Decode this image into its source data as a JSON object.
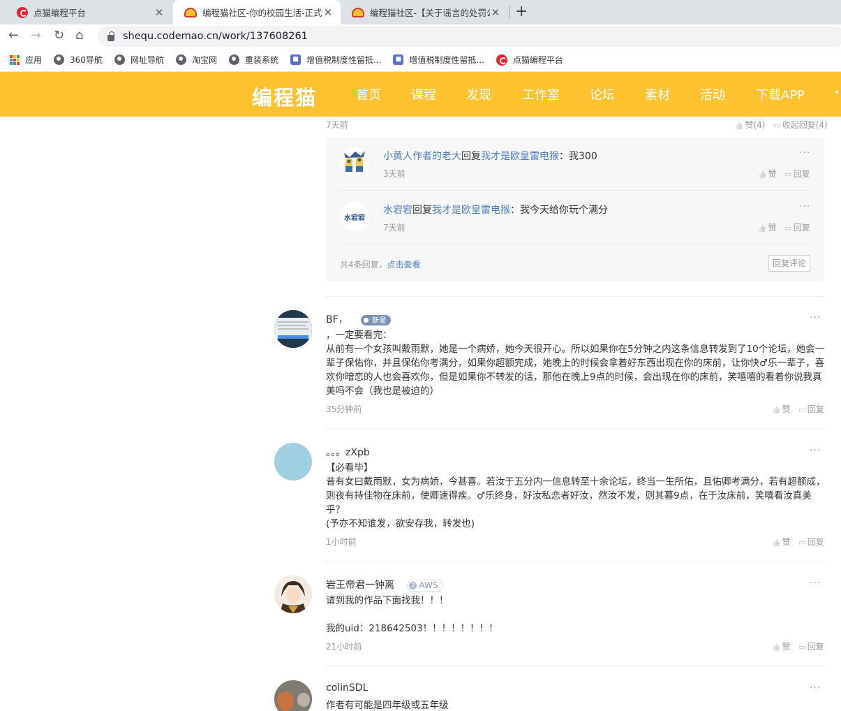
{
  "browser": {
    "tabs": [
      {
        "title": "点猫编程平台",
        "active": false
      },
      {
        "title": "编程猫社区-你的校园生活-正式版",
        "active": true
      },
      {
        "title": "编程猫社区-【关于谣言的处罚公",
        "active": false
      }
    ],
    "url": "shequ.codemao.cn/work/137608261",
    "bookmarks": [
      "应用",
      "360导航",
      "网址导航",
      "淘宝网",
      "重装系统",
      "增值税制度性留抵...",
      "增值税制度性留抵...",
      "点猫编程平台"
    ]
  },
  "site": {
    "logo": "编程猫",
    "nav": [
      "首页",
      "课程",
      "发现",
      "工作室",
      "论坛",
      "素材",
      "活动",
      "下载APP"
    ],
    "brand_color": "#fec12f"
  },
  "top_comment_meta": {
    "time": "7天前",
    "like": "赞(4)",
    "collapse": "收起回复(4)"
  },
  "replies": [
    {
      "user": "小黄人作者的老大",
      "verb": "回复",
      "target": "我才是欧皇雷电猴",
      "text": "：我300",
      "time": "3天前"
    },
    {
      "user": "水宕宕",
      "verb": "回复",
      "target": "我才是欧皇雷电猴",
      "text": "：我今天给你玩个满分",
      "time": "7天前",
      "avatar_text": "水宕宕"
    }
  ],
  "reply_footer": {
    "count": "共4条回复，",
    "view": "点击查看",
    "button": "回复评论"
  },
  "actions": {
    "like": "赞",
    "reply": "回复",
    "more": "···"
  },
  "comments": [
    {
      "user": "BF，",
      "badge": "新星",
      "lines": [
        "，一定要看完：",
        "从前有一个女孩叫戴雨默，她是一个病娇，她今天很开心。所以如果你在5分钟之内这条信息转发到了10个论坛，她会一辈子保佑你，并且保佑你考满分，如果你超额完成，她晚上的时候会拿着好东西出现在你的床前，让你快♂乐一辈子，喜欢你暗恋的人也会喜欢你，但是如果你不转发的话，那他在晚上9点的时候，会出现在你的床前，笑嘻嘻的看着你说我真美吗不会（我也是被迫的）"
      ],
      "time": "35分钟前"
    },
    {
      "user": "。。。zXpb",
      "lines": [
        "【必看毕】",
        "昔有女曰戴雨默，女为病娇，今甚喜。若汝于五分内一信息转至十余论坛，终当一生所佑，且佑卿考满分，若有超额成，则夜有持佳物在床前，使卿速得疾。♂乐终身，好汝私恋者好汝，然汝不发，则其暮9点，在于汝床前，笑嘻看汝真美乎？",
        "(予亦不知谁发，欲安存我，转发也)"
      ],
      "time": "1小时前"
    },
    {
      "user": "岩王帝君一钟离",
      "badge": "AWS",
      "badge_num": "2",
      "lines": [
        "请到我的作品下面找我！！！",
        "",
        "我的uid：218642503！！！！！！！！"
      ],
      "time": "21小时前"
    },
    {
      "user": "colinSDL",
      "lines": [
        "作者有可能是四年级或五年级"
      ]
    }
  ]
}
